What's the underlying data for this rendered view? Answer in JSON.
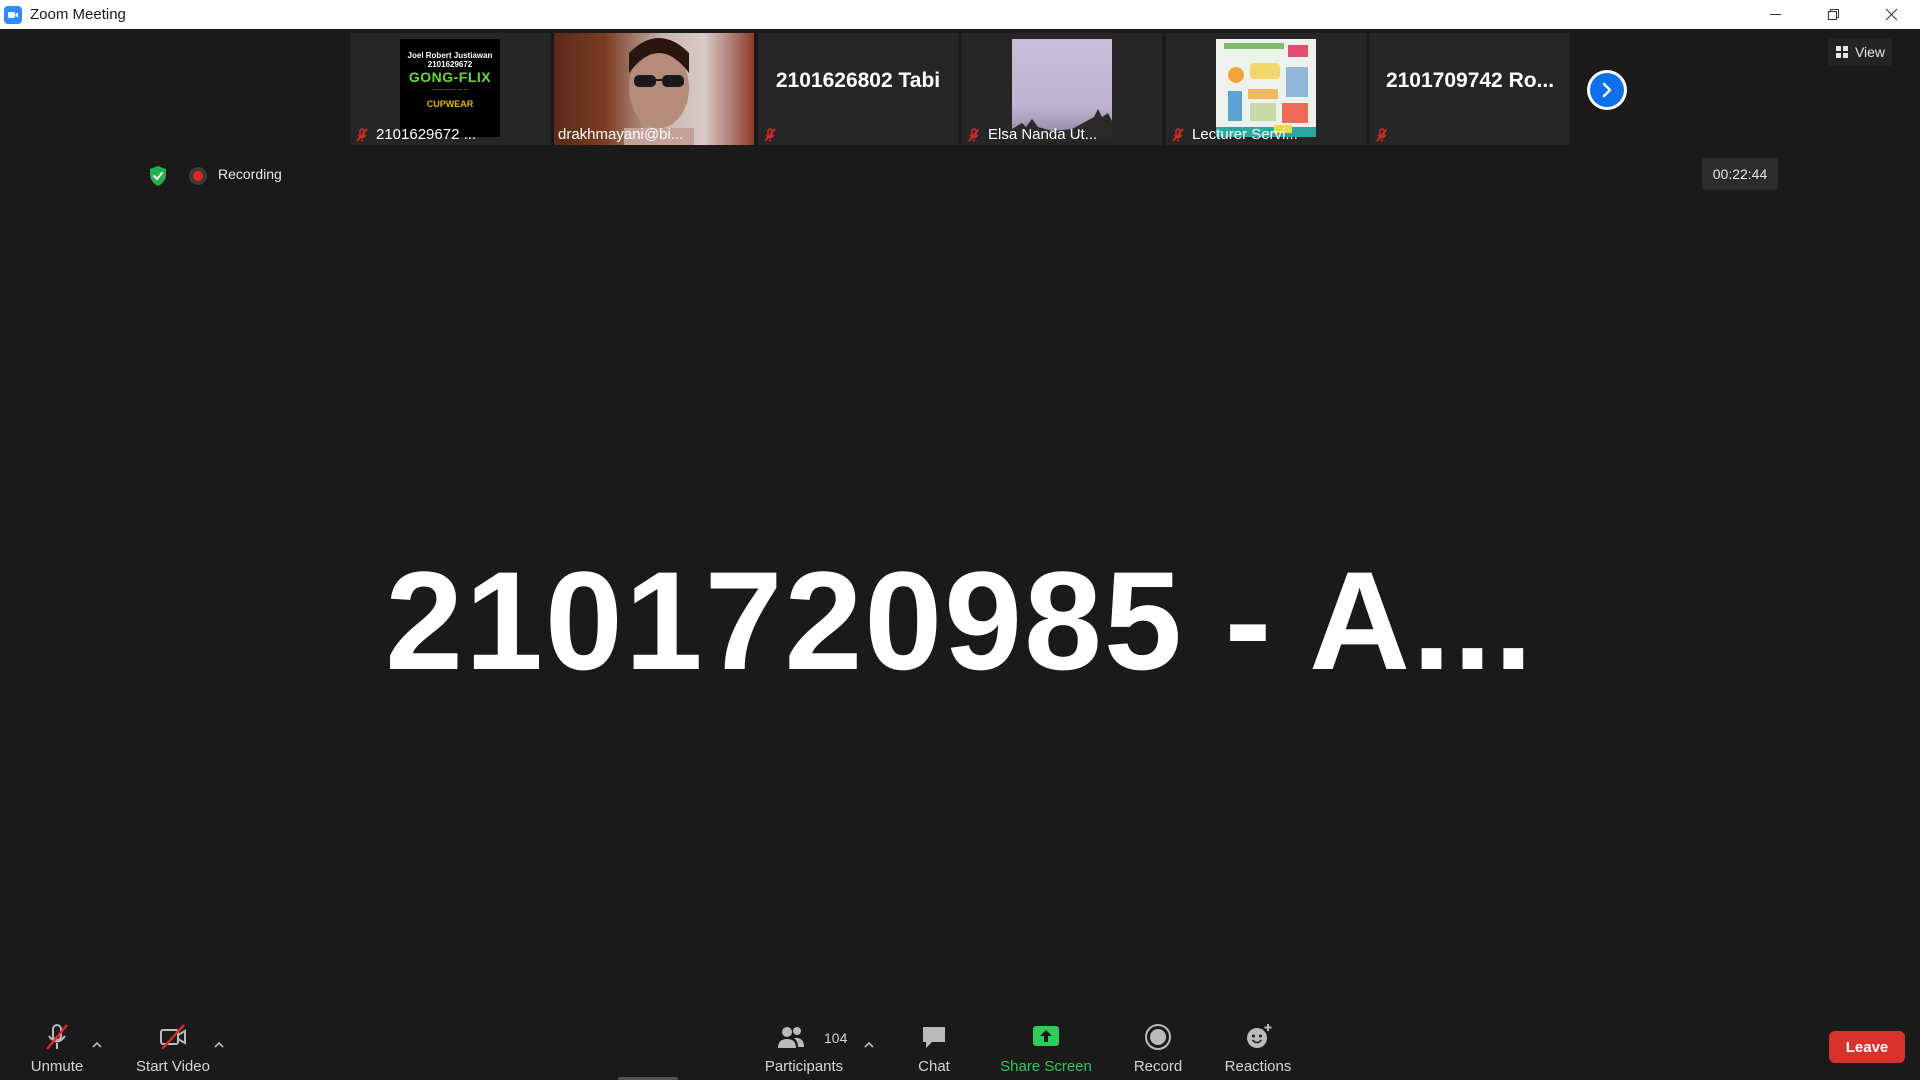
{
  "window": {
    "title": "Zoom Meeting",
    "icon": "zoom-camera-icon"
  },
  "gallery": {
    "tiles": [
      {
        "type": "image",
        "caption": "2101629672 ...",
        "muted": true,
        "thumb": {
          "line1": "Joel Robert Justiawan",
          "line2": "2101629672",
          "line3": "GONG-FLIX",
          "line5": "CUPWEAR"
        }
      },
      {
        "type": "video",
        "caption": "drakhmayani@bi...",
        "muted": false
      },
      {
        "type": "name",
        "name": "2101626802 Tabi",
        "muted": true
      },
      {
        "type": "image",
        "caption": "Elsa Nanda Ut...",
        "muted": true
      },
      {
        "type": "image",
        "caption": "Lecturer Servi...",
        "muted": true
      },
      {
        "type": "name",
        "name": "2101709742  Ro...",
        "muted": true
      }
    ],
    "next_icon": "chevron-right-icon"
  },
  "view_button": {
    "label": "View",
    "icon": "grid-icon"
  },
  "status": {
    "security_icon": "shield-check-icon",
    "recording_label": "Recording",
    "timer": "00:22:44"
  },
  "active_speaker": {
    "name": "2101720985  -  A..."
  },
  "toolbar": {
    "unmute_label": "Unmute",
    "start_video_label": "Start Video",
    "participants_label": "Participants",
    "participants_count": "104",
    "chat_label": "Chat",
    "share_label": "Share Screen",
    "record_label": "Record",
    "reactions_label": "Reactions",
    "leave_label": "Leave"
  },
  "colors": {
    "background": "#1a1a1a",
    "accent_blue": "#0e71eb",
    "share_green": "#2ecc5a",
    "leave_red": "#d8322d",
    "mute_red": "#e02828"
  }
}
